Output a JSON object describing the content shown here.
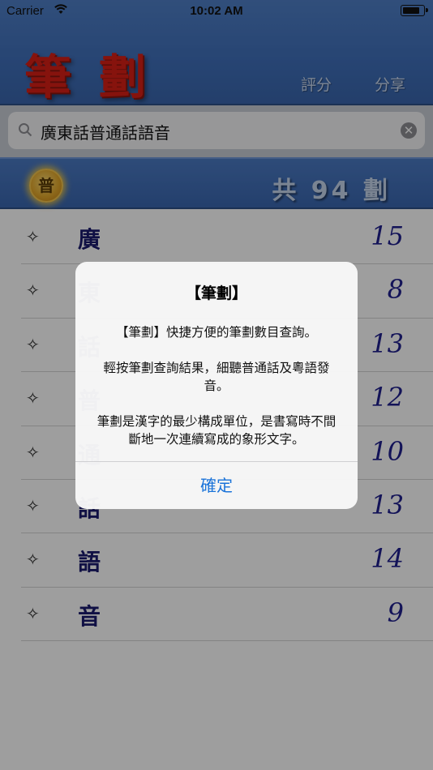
{
  "status_bar": {
    "carrier": "Carrier",
    "time": "10:02 AM",
    "battery_level": 0.85
  },
  "header": {
    "title": "筆劃",
    "rate_label": "評分",
    "share_label": "分享"
  },
  "search": {
    "value": "廣東話普通話語音"
  },
  "info_bar": {
    "sound_badge": "普",
    "total_label": "共 94 劃"
  },
  "list": {
    "items": [
      {
        "char": "廣",
        "count": "15"
      },
      {
        "char": "東",
        "count": "8"
      },
      {
        "char": "話",
        "count": "13"
      },
      {
        "char": "普",
        "count": "12"
      },
      {
        "char": "通",
        "count": "10"
      },
      {
        "char": "話",
        "count": "13"
      },
      {
        "char": "語",
        "count": "14"
      },
      {
        "char": "音",
        "count": "9"
      }
    ]
  },
  "alert": {
    "title": "【筆劃】",
    "paragraphs": [
      "【筆劃】快捷方便的筆劃數目查詢。",
      "輕按筆劃查詢結果，細聽普通話及粵語發音。",
      "筆劃是漢字的最少構成單位，是書寫時不間斷地一次連續寫成的象形文字。"
    ],
    "confirm_label": "確定"
  },
  "colors": {
    "header_blue": "#4f7fc7",
    "title_red": "#d91f16",
    "count_navy": "#1f1f8f",
    "alert_button_blue": "#1a73d9"
  },
  "icons": [
    "wifi-icon",
    "battery-icon",
    "search-icon",
    "clear-icon",
    "sparkle-icon"
  ]
}
